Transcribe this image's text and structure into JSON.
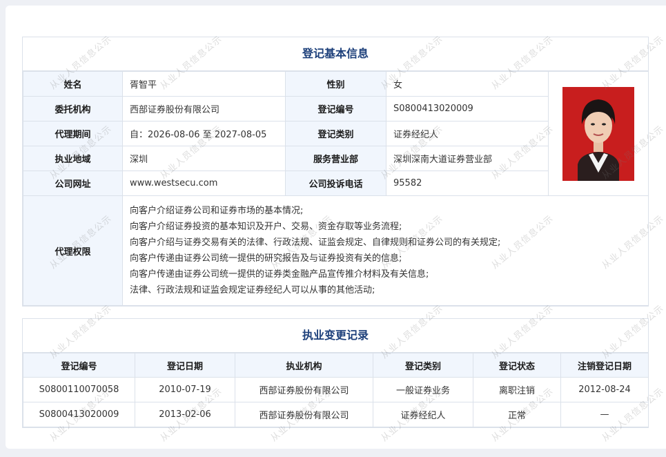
{
  "basic": {
    "title": "登记基本信息",
    "name_label": "姓名",
    "name": "胥智平",
    "gender_label": "性别",
    "gender": "女",
    "org_label": "委托机构",
    "org": "西部证券股份有限公司",
    "regno_label": "登记编号",
    "regno": "S0800413020009",
    "period_label": "代理期间",
    "period": "自：2026-08-06 至 2027-08-05",
    "regtype_label": "登记类别",
    "regtype": "证券经纪人",
    "region_label": "执业地域",
    "region": "深圳",
    "branch_label": "服务营业部",
    "branch": "深圳深南大道证券营业部",
    "site_label": "公司网址",
    "site": "www.westsecu.com",
    "phone_label": "公司投诉电话",
    "phone": "95582",
    "perm_label": "代理权限",
    "permissions": [
      "向客户介绍证券公司和证券市场的基本情况;",
      "向客户介绍证券投资的基本知识及开户、交易、资金存取等业务流程;",
      "向客户介绍与证券交易有关的法律、行政法规、证监会规定、自律规则和证券公司的有关规定;",
      "向客户传递由证券公司统一提供的研究报告及与证券投资有关的信息;",
      "向客户传递由证券公司统一提供的证券类金融产品宣传推介材料及有关信息;",
      "法律、行政法规和证监会规定证券经纪人可以从事的其他活动;"
    ]
  },
  "history": {
    "title": "执业变更记录",
    "headers": [
      "登记编号",
      "登记日期",
      "执业机构",
      "登记类别",
      "登记状态",
      "注销登记日期"
    ],
    "rows": [
      [
        "S0800110070058",
        "2010-07-19",
        "西部证券股份有限公司",
        "一般证券业务",
        "离职注销",
        "2012-08-24"
      ],
      [
        "S0800413020009",
        "2013-02-06",
        "西部证券股份有限公司",
        "证券经纪人",
        "正常",
        "—"
      ]
    ]
  },
  "watermark": "从业人员信息公示",
  "colors": {
    "title": "#1c3f7a",
    "label_bg": "#f1f6fd",
    "border": "#dbe1ea"
  },
  "photo": {
    "icon": "portrait-photo"
  }
}
